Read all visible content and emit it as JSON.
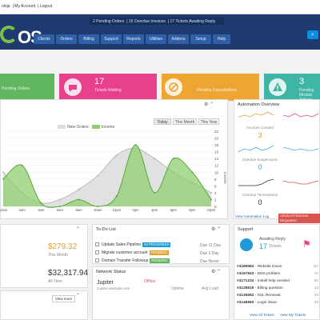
{
  "topbar": {
    "links": [
      "ninja",
      "My Account",
      "Logout"
    ]
  },
  "header": {
    "logo_text": "OS",
    "notices": [
      "2 Pending Orders",
      "15 Overdue Invoices",
      "17 Tickets Awaiting Reply"
    ],
    "nav": [
      "Clients",
      "Orders",
      "Billing",
      "Support",
      "Reports",
      "Utilities",
      "Addons",
      "Setup",
      "Help"
    ],
    "search_icon": "search-icon"
  },
  "stats": [
    {
      "number": "",
      "label": "Pending Orders",
      "color": "#5fb85f"
    },
    {
      "number": "17",
      "label": "Tickets Waiting",
      "color": "#e8418c"
    },
    {
      "number": "",
      "label": "Pending Cancellations",
      "color": "#efa532"
    },
    {
      "number": "3",
      "label": "Pending Module Actions",
      "color": "#3fb6a5"
    }
  ],
  "system_overview": {
    "buttons": [
      "Today",
      "This Month",
      "This Year"
    ],
    "legend": [
      "New Orders",
      "Income"
    ],
    "colors": {
      "new_orders": "#dcdcdc",
      "income": "#8fcf70"
    }
  },
  "chart_data": {
    "type": "area",
    "title": "",
    "x": [
      "12am",
      "2am",
      "4am",
      "6am",
      "8am",
      "10am",
      "12pm",
      "2pm",
      "4pm",
      "6pm",
      "8pm",
      "10pm"
    ],
    "series": [
      {
        "name": "New Orders",
        "values": [
          10,
          4,
          1,
          2,
          5,
          9,
          15,
          17,
          14,
          10,
          7,
          4
        ]
      },
      {
        "name": "Income",
        "values": [
          8,
          12,
          1,
          0,
          2,
          0,
          3,
          18,
          4,
          14,
          10,
          2
        ]
      }
    ],
    "y_ticks": [
      "0",
      "2",
      "4",
      "6",
      "8",
      "10",
      "12",
      "14",
      "16",
      "18",
      "20",
      "22"
    ],
    "ylabel": "Income",
    "ylim": [
      0,
      22
    ],
    "grid": true,
    "legend": "top"
  },
  "automation": {
    "title": "Automation Overview",
    "items": [
      {
        "label": "Invoices Created",
        "value": "3",
        "color": "#e0a230"
      },
      {
        "label": "",
        "value": "",
        "color": "#e8418c"
      },
      {
        "label": "Overdue Suspensions",
        "value": "0",
        "color": "#47a8e0"
      },
      {
        "label": "",
        "value": "",
        "color": "#47a8e0"
      },
      {
        "label": "Overdue Terminations",
        "value": "0",
        "color": "#333333"
      },
      {
        "label": "",
        "value": "",
        "color": "#e05050"
      }
    ],
    "footer_link": "View Automation Log",
    "footer_badge": "CRON ATTENTION REQUIRED",
    "badge_color": "#d9534f"
  },
  "billing": {
    "value1": "$279.32",
    "label1": "This Month",
    "value2": "$32,317.94",
    "label2": "All Time",
    "value1_color": "#e0a230"
  },
  "todo": {
    "title": "To-Do List",
    "items": [
      {
        "text": "Update Sales Pipeline",
        "badge": "IN PROGRESS",
        "badge_color": "#1f9ad6",
        "due": "Due 11 Day"
      },
      {
        "text": "Migrate customer account",
        "badge": "PENDING",
        "badge_color": "#e0a230",
        "due": "Due 1 Day"
      },
      {
        "text": "Domain Transfer Followup",
        "badge": "PENDING",
        "badge_color": "#5fb85f",
        "due": "Due Never"
      }
    ]
  },
  "network": {
    "title": "Network Status",
    "server": "Jupiter",
    "server_sub": "Jupiter.example.com",
    "status": "Offline",
    "uptime": "Uptime",
    "avg_load": "Avg Load"
  },
  "support": {
    "title": "Support",
    "awaiting": "Awaiting Reply",
    "count": "17",
    "count_label": "Tickets",
    "tickets": [
      {
        "id": "#4189584",
        "subject": "Website Down",
        "time": "3m"
      },
      {
        "id": "#4167843",
        "subject": "DNS problem",
        "time": "1h"
      },
      {
        "id": "#4171234",
        "subject": "Install help needed",
        "time": "5h"
      },
      {
        "id": "#4128819",
        "subject": "Billing question",
        "time": "1d"
      },
      {
        "id": "#4135552",
        "subject": "SSL Renewal",
        "time": "2d"
      },
      {
        "id": "#4146660",
        "subject": "Login issue",
        "time": "3d"
      }
    ],
    "links": [
      "View All Tickets",
      "View My Tickets"
    ]
  },
  "bottom_left": {
    "button": "View more"
  }
}
